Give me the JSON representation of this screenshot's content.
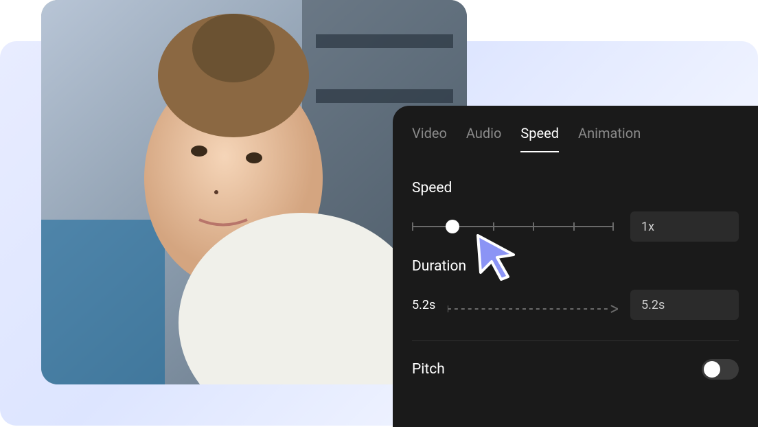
{
  "tabs": {
    "video": "Video",
    "audio": "Audio",
    "speed": "Speed",
    "animation": "Animation"
  },
  "speed": {
    "label": "Speed",
    "value": "1x"
  },
  "duration": {
    "label": "Duration",
    "current": "5.2s",
    "target": "5.2s"
  },
  "pitch": {
    "label": "Pitch"
  }
}
